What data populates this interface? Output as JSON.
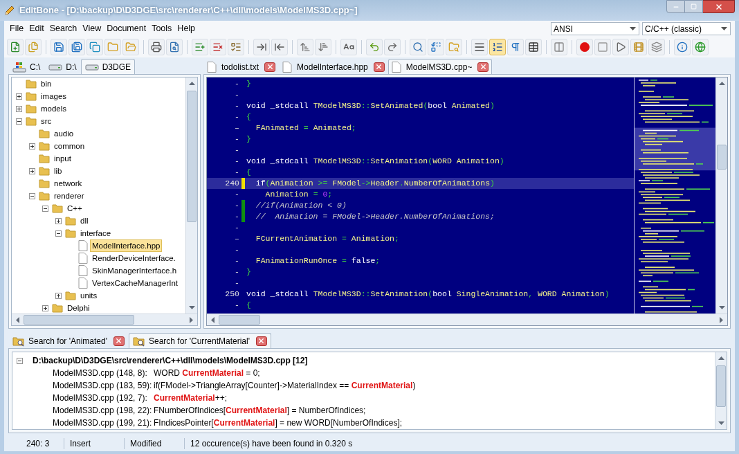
{
  "window": {
    "title": "EditBone - [D:\\backup\\D\\D3DGE\\src\\renderer\\C++\\dll\\models\\ModelMS3D.cpp~]"
  },
  "menu": [
    "File",
    "Edit",
    "Search",
    "View",
    "Document",
    "Tools",
    "Help"
  ],
  "encoding": {
    "value": "ANSI"
  },
  "highlighter": {
    "value": "C/C++ (classic)"
  },
  "toolbar": [
    [
      {
        "pressed": false
      },
      {
        "pressed": false
      }
    ],
    [
      {
        "pressed": false
      },
      {
        "pressed": false
      },
      {
        "pressed": false
      },
      {
        "pressed": false
      },
      {
        "pressed": false
      }
    ],
    [
      {
        "pressed": false
      },
      {
        "pressed": false
      }
    ],
    [
      {
        "pressed": false
      },
      {
        "pressed": false
      },
      {
        "pressed": false
      }
    ],
    [
      {
        "pressed": false
      },
      {
        "pressed": false
      }
    ],
    [
      {
        "pressed": false
      },
      {
        "pressed": false
      }
    ],
    [
      {
        "pressed": false
      }
    ],
    [
      {
        "pressed": false
      },
      {
        "pressed": false
      }
    ],
    [
      {
        "pressed": false
      },
      {
        "pressed": false
      },
      {
        "pressed": false
      }
    ],
    [
      {
        "pressed": false
      },
      {
        "pressed": true
      },
      {
        "pressed": false
      },
      {
        "pressed": false
      }
    ],
    [
      {
        "pressed": false
      }
    ],
    [
      {
        "pressed": false
      },
      {
        "pressed": false
      },
      {
        "pressed": false
      },
      {
        "pressed": false
      },
      {
        "pressed": false
      }
    ],
    [
      {
        "pressed": false
      },
      {
        "pressed": false
      }
    ]
  ],
  "drive_tabs": [
    {
      "label": "C:\\",
      "kind": "system",
      "selected": false
    },
    {
      "label": "D:\\",
      "kind": "drive",
      "selected": false
    },
    {
      "label": "D3DGE",
      "kind": "drive",
      "selected": true
    }
  ],
  "file_tabs": [
    {
      "label": "todolist.txt",
      "selected": false
    },
    {
      "label": "ModelInterface.hpp",
      "selected": false
    },
    {
      "label": "ModelMS3D.cpp~",
      "selected": true
    }
  ],
  "tree": {
    "items": [
      {
        "label": "bin",
        "kind": "folder",
        "selected": false
      },
      {
        "label": "images",
        "kind": "folder",
        "expanded": false,
        "selected": false
      },
      {
        "label": "models",
        "kind": "folder",
        "expanded": false,
        "selected": false
      },
      {
        "label": "src",
        "kind": "folder",
        "expanded": true,
        "selected": false,
        "children": [
          {
            "label": "audio",
            "kind": "folder",
            "selected": false
          },
          {
            "label": "common",
            "kind": "folder",
            "expanded": false,
            "selected": false
          },
          {
            "label": "input",
            "kind": "folder",
            "selected": false
          },
          {
            "label": "lib",
            "kind": "folder",
            "expanded": false,
            "selected": false
          },
          {
            "label": "network",
            "kind": "folder",
            "selected": false
          },
          {
            "label": "renderer",
            "kind": "folder",
            "expanded": true,
            "selected": false,
            "children": [
              {
                "label": "C++",
                "kind": "folder",
                "expanded": true,
                "selected": false,
                "children": [
                  {
                    "label": "dll",
                    "kind": "folder",
                    "expanded": false,
                    "selected": false
                  },
                  {
                    "label": "interface",
                    "kind": "folder",
                    "expanded": true,
                    "selected": false,
                    "children": [
                      {
                        "label": "ModelInterface.hpp",
                        "kind": "file",
                        "selected": true
                      },
                      {
                        "label": "RenderDeviceInterface.",
                        "kind": "file",
                        "selected": false
                      },
                      {
                        "label": "SkinManagerInterface.h",
                        "kind": "file",
                        "selected": false
                      },
                      {
                        "label": "VertexCacheManagerInt",
                        "kind": "file",
                        "selected": false
                      }
                    ]
                  },
                  {
                    "label": "units",
                    "kind": "folder",
                    "expanded": false,
                    "selected": false
                  }
                ]
              },
              {
                "label": "Delphi",
                "kind": "folder",
                "expanded": false,
                "selected": false
              }
            ]
          }
        ]
      }
    ]
  },
  "code_lines": [
    {
      "gutter": "-",
      "current": false,
      "segments": [
        {
          "text": "}",
          "kind": "symbol"
        }
      ]
    },
    {
      "gutter": "-",
      "current": false
    },
    {
      "gutter": "-",
      "current": false,
      "segments": [
        {
          "text": "void _stdcall ",
          "kind": "keyword"
        },
        {
          "text": "TModelMS3D",
          "kind": "ident"
        },
        {
          "text": "::",
          "kind": "symbol"
        },
        {
          "text": "SetAnimated",
          "kind": "ident"
        },
        {
          "text": "(",
          "kind": "symbol"
        },
        {
          "text": "bool ",
          "kind": "keyword"
        },
        {
          "text": "Animated",
          "kind": "ident"
        },
        {
          "text": ")",
          "kind": "symbol"
        }
      ]
    },
    {
      "gutter": "-",
      "current": false,
      "segments": [
        {
          "text": "{",
          "kind": "symbol"
        }
      ]
    },
    {
      "gutter": "–",
      "current": false,
      "segments": [
        {
          "text": "  FAnimated ",
          "kind": "ident"
        },
        {
          "text": "= ",
          "kind": "symbol"
        },
        {
          "text": "Animated",
          "kind": "ident"
        },
        {
          "text": ";",
          "kind": "symbol"
        }
      ]
    },
    {
      "gutter": "-",
      "current": false,
      "segments": [
        {
          "text": "}",
          "kind": "symbol"
        }
      ]
    },
    {
      "gutter": "-",
      "current": false
    },
    {
      "gutter": "-",
      "current": false,
      "segments": [
        {
          "text": "void _stdcall ",
          "kind": "keyword"
        },
        {
          "text": "TModelMS3D",
          "kind": "ident"
        },
        {
          "text": "::",
          "kind": "symbol"
        },
        {
          "text": "SetAnimation",
          "kind": "ident"
        },
        {
          "text": "(",
          "kind": "symbol"
        },
        {
          "text": "WORD Animation",
          "kind": "ident"
        },
        {
          "text": ")",
          "kind": "symbol"
        }
      ]
    },
    {
      "gutter": "-",
      "current": false,
      "segments": [
        {
          "text": "{",
          "kind": "symbol"
        }
      ]
    },
    {
      "gutter": "240",
      "color": "#f0e000",
      "current": true,
      "segments": [
        {
          "text": "  if",
          "kind": "keyword"
        },
        {
          "text": "(",
          "kind": "symbol"
        },
        {
          "text": "Animation ",
          "kind": "ident"
        },
        {
          "text": ">= ",
          "kind": "symbol"
        },
        {
          "text": "FModel",
          "kind": "ident"
        },
        {
          "text": "->",
          "kind": "symbol"
        },
        {
          "text": "Header",
          "kind": "ident"
        },
        {
          "text": ".",
          "kind": "symbol"
        },
        {
          "text": "NumberOfAnimations",
          "kind": "ident"
        },
        {
          "text": ")",
          "kind": "symbol"
        }
      ]
    },
    {
      "gutter": "-",
      "current": false,
      "segments": [
        {
          "text": "    Animation ",
          "kind": "ident"
        },
        {
          "text": "= ",
          "kind": "symbol"
        },
        {
          "text": "0",
          "kind": "number"
        },
        {
          "text": ";",
          "kind": "symbol"
        }
      ]
    },
    {
      "gutter": "-",
      "color": "#109010",
      "current": false,
      "segments": [
        {
          "text": "  //if(Animation < 0)",
          "kind": "comment"
        }
      ]
    },
    {
      "gutter": "-",
      "color": "#109010",
      "current": false,
      "segments": [
        {
          "text": "  //  Animation = FModel->Header.NumberOfAnimations;",
          "kind": "comment"
        }
      ]
    },
    {
      "gutter": "-",
      "current": false
    },
    {
      "gutter": "–",
      "current": false,
      "segments": [
        {
          "text": "  FCurrentAnimation ",
          "kind": "ident"
        },
        {
          "text": "= ",
          "kind": "symbol"
        },
        {
          "text": "Animation",
          "kind": "ident"
        },
        {
          "text": ";",
          "kind": "symbol"
        }
      ]
    },
    {
      "gutter": "-",
      "current": false
    },
    {
      "gutter": "-",
      "current": false,
      "segments": [
        {
          "text": "  FAnimationRunOnce ",
          "kind": "ident"
        },
        {
          "text": "= ",
          "kind": "symbol"
        },
        {
          "text": "false",
          "kind": "keyword"
        },
        {
          "text": ";",
          "kind": "symbol"
        }
      ]
    },
    {
      "gutter": "-",
      "current": false,
      "segments": [
        {
          "text": "}",
          "kind": "symbol"
        }
      ]
    },
    {
      "gutter": "-",
      "current": false
    },
    {
      "gutter": "250",
      "current": false,
      "segments": [
        {
          "text": "void _stdcall ",
          "kind": "keyword"
        },
        {
          "text": "TModelMS3D",
          "kind": "ident"
        },
        {
          "text": "::",
          "kind": "symbol"
        },
        {
          "text": "SetAnimation",
          "kind": "ident"
        },
        {
          "text": "(",
          "kind": "symbol"
        },
        {
          "text": "bool ",
          "kind": "keyword"
        },
        {
          "text": "SingleAnimation",
          "kind": "ident"
        },
        {
          "text": ", ",
          "kind": "symbol"
        },
        {
          "text": "WORD Animation",
          "kind": "ident"
        },
        {
          "text": ")",
          "kind": "symbol"
        }
      ]
    },
    {
      "gutter": "-",
      "current": false,
      "segments": [
        {
          "text": "{",
          "kind": "symbol"
        }
      ]
    }
  ],
  "search_tabs": [
    {
      "label": "Search for 'Animated'",
      "selected": false
    },
    {
      "label": "Search for 'CurrentMaterial'",
      "selected": true
    }
  ],
  "results": {
    "file": "D:\\backup\\D\\D3DGE\\src\\renderer\\C++\\dll\\models\\ModelMS3D.cpp [12]",
    "expanded": true,
    "rows": [
      {
        "location": "ModelMS3D.cpp (148, 8):",
        "code": "WORD **CurrentMaterial** = 0;"
      },
      {
        "location": "ModelMS3D.cpp (183, 59):",
        "code": "if(FModel->TriangleArray[Counter]->MaterialIndex == **CurrentMaterial**)"
      },
      {
        "location": "ModelMS3D.cpp (192, 7):",
        "code": "**CurrentMaterial**++;"
      },
      {
        "location": "ModelMS3D.cpp (198, 22):",
        "code": "FNumberOfIndices[**CurrentMaterial**] = NumberOfIndices;"
      },
      {
        "location": "ModelMS3D.cpp (199, 21):",
        "code": "FIndicesPointer[**CurrentMaterial**] = new WORD[NumberOfIndices];"
      }
    ]
  },
  "status_bar": [
    "240: 3",
    "Insert",
    "Modified",
    "12 occurence(s) have been found in 0.320 s"
  ]
}
